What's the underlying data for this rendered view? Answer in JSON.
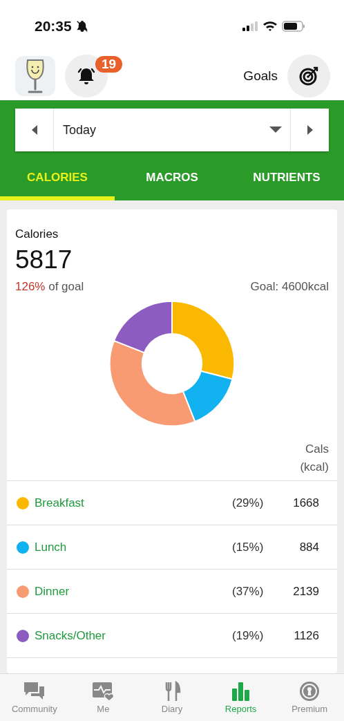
{
  "status_bar": {
    "time": "20:35"
  },
  "header": {
    "notifications": {
      "badge": "19"
    },
    "goals": {
      "label": "Goals"
    }
  },
  "date_picker": {
    "value": "Today"
  },
  "tabs": [
    {
      "label": "CALORIES",
      "selected": true
    },
    {
      "label": "MACROS",
      "selected": false
    },
    {
      "label": "NUTRIENTS",
      "selected": false
    }
  ],
  "summary": {
    "title": "Calories",
    "total": "5817",
    "percent": "126%",
    "percent_suffix": "of goal",
    "goal": "Goal: 4600kcal"
  },
  "chart_data": {
    "type": "donut",
    "values": [
      29,
      15,
      37,
      19
    ]
  },
  "table": {
    "column_header": [
      "Cals",
      "(kcal)"
    ],
    "rows": [
      {
        "meal": "Breakfast",
        "color": "#fbb800",
        "share": "(29%)",
        "cals": "1668"
      },
      {
        "meal": "Lunch",
        "color": "#12b1f0",
        "share": "(15%)",
        "cals": "884"
      },
      {
        "meal": "Dinner",
        "color": "#f89a72",
        "share": "(37%)",
        "cals": "2139"
      },
      {
        "meal": "Snacks/Other",
        "color": "#8c5cc0",
        "share": "(19%)",
        "cals": "1126"
      }
    ]
  },
  "bottom_nav": [
    {
      "label": "Community",
      "kind": "community",
      "selected": false
    },
    {
      "label": "Me",
      "kind": "me",
      "selected": false
    },
    {
      "label": "Diary",
      "kind": "diary",
      "selected": false
    },
    {
      "label": "Reports",
      "kind": "reports",
      "selected": true
    },
    {
      "label": "Premium",
      "kind": "premium",
      "selected": false
    }
  ]
}
